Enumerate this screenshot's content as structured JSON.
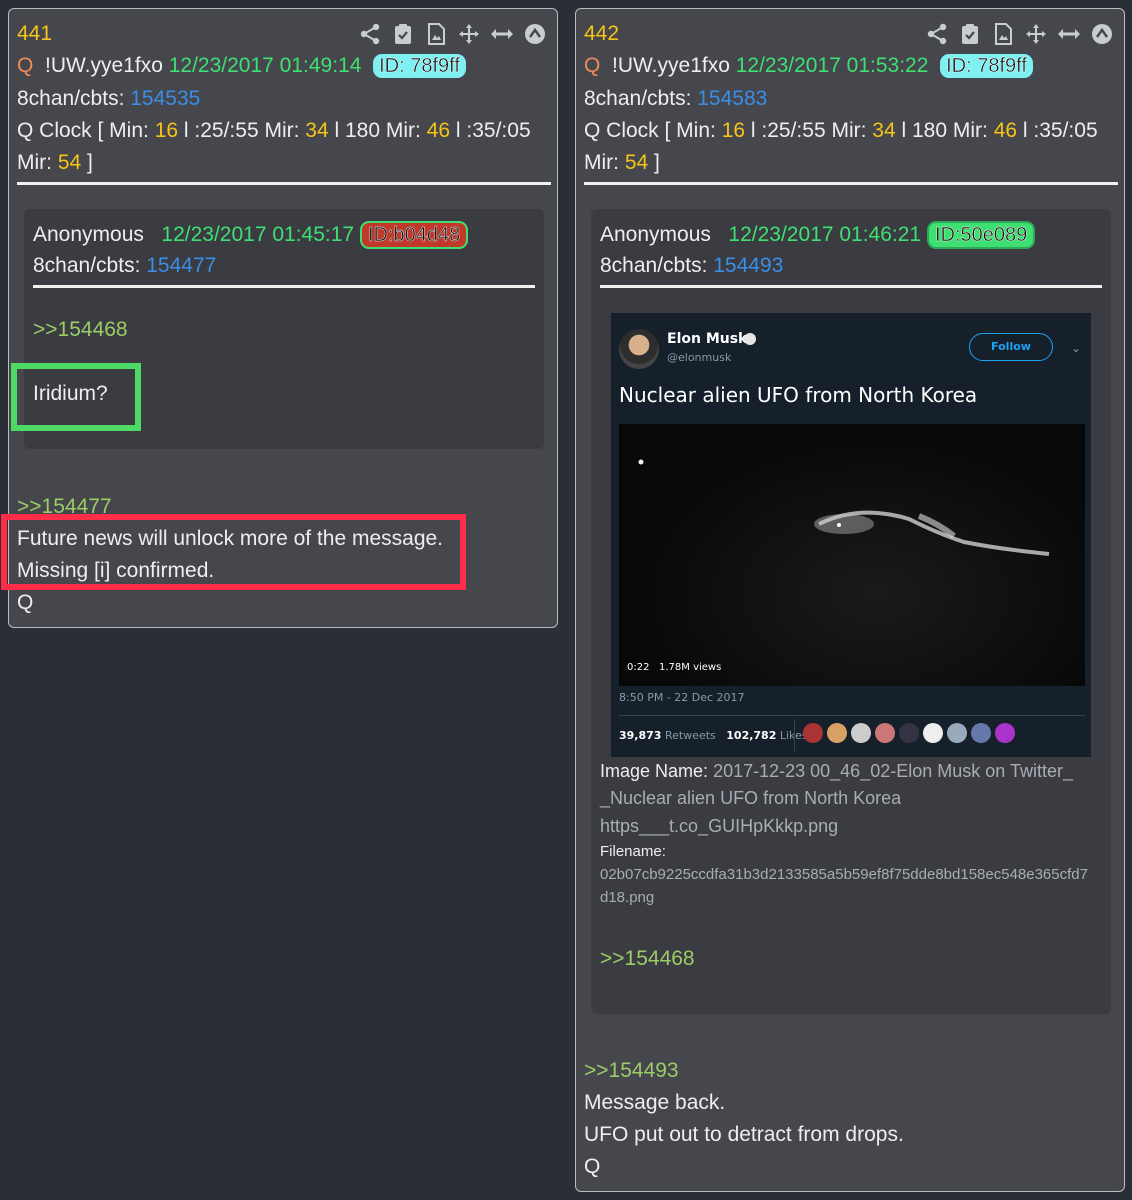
{
  "posts": [
    {
      "number": "441",
      "author_prefix": "Q",
      "tripcode": "!UW.yye1fxo",
      "timestamp": "12/23/2017 01:49:14",
      "id": "ID: 78f9ff",
      "board_label": "8chan/cbts:",
      "board_link": "154535",
      "clock_prefix": "Q Clock [ Min:",
      "clock_min": "16",
      "clock_mid1": "l :25/:55 Mir:",
      "clock_mir1": "34",
      "clock_mid2": "l 180 Mir:",
      "clock_mir2": "46",
      "clock_mid3": "l :35/:05",
      "clock_mir_label": "Mir:",
      "clock_mir3": "54",
      "clock_end": "]",
      "quoted": {
        "author": "Anonymous",
        "timestamp": "12/23/2017 01:45:17",
        "id": "ID:b04d48",
        "board_label": "8chan/cbts:",
        "board_link": "154477",
        "reply_link": ">>154468",
        "text": "Iridium?"
      },
      "reply_link": ">>154477",
      "lines": [
        "Future news will unlock more of the message.",
        "Missing [i] confirmed.",
        "Q"
      ]
    },
    {
      "number": "442",
      "author_prefix": "Q",
      "tripcode": "!UW.yye1fxo",
      "timestamp": "12/23/2017 01:53:22",
      "id": "ID: 78f9ff",
      "board_label": "8chan/cbts:",
      "board_link": "154583",
      "clock_prefix": "Q Clock [ Min:",
      "clock_min": "16",
      "clock_mid1": "l :25/:55 Mir:",
      "clock_mir1": "34",
      "clock_mid2": "l 180 Mir:",
      "clock_mir2": "46",
      "clock_mid3": "l :35/:05",
      "clock_mir_label": "Mir:",
      "clock_mir3": "54",
      "clock_end": "]",
      "quoted": {
        "author": "Anonymous",
        "timestamp": "12/23/2017 01:46:21",
        "id": "ID:50e089",
        "board_label": "8chan/cbts:",
        "board_link": "154493",
        "image_name_label": "Image Name:",
        "image_name_1": "2017-12-23 00_46_02-Elon Musk on Twitter_",
        "image_name_2": "_Nuclear alien UFO from North Korea",
        "image_name_3": "https___t.co_GUIHpKkkp.png",
        "filename_label": "Filename:",
        "filename_1": "02b07cb9225ccdfa31b3d2133585a5b59ef8f75dde8bd158ec548e365cfd7",
        "filename_2": "d18.png",
        "reply_link": ">>154468",
        "tweet": {
          "name": "Elon Musk",
          "handle": "@elonmusk",
          "follow": "Follow",
          "text": "Nuclear alien UFO from North Korea",
          "video_time": "0:22",
          "views": "1.78M views",
          "date": "8:50 PM - 22 Dec 2017",
          "retweets": "39,873",
          "retweets_label": "Retweets",
          "likes": "102,782",
          "likes_label": "Likes"
        }
      },
      "reply_link": ">>154493",
      "lines": [
        "Message back.",
        "UFO put out to detract from drops.",
        "Q"
      ]
    }
  ],
  "colors": {
    "highlight_green": "#4cd964",
    "highlight_red": "#ff2d47",
    "id_cyan": "#7ff0f2",
    "id_red": "#c0392b",
    "id_green": "#3fe072"
  },
  "icons": [
    "share-icon",
    "clipboard-check-icon",
    "document-icon",
    "move-icon",
    "expand-horizontal-icon",
    "collapse-up-icon"
  ]
}
